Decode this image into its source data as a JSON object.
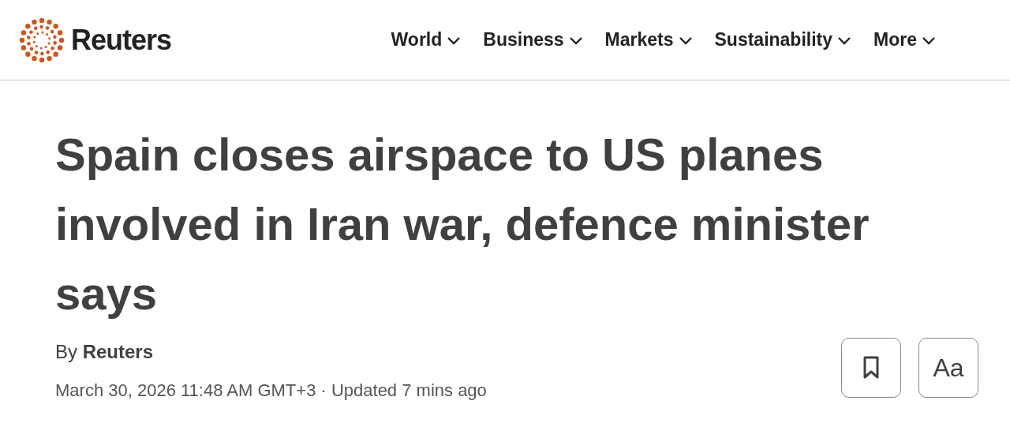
{
  "header": {
    "logo_text": "Reuters",
    "nav": [
      {
        "label": "World",
        "expanded": false
      },
      {
        "label": "Business",
        "expanded": false
      },
      {
        "label": "Markets",
        "expanded": false
      },
      {
        "label": "Sustainability",
        "expanded": false
      },
      {
        "label": "More",
        "expanded": false
      }
    ]
  },
  "article": {
    "headline": "Spain closes airspace to US planes involved in Iran war, defence minister says",
    "byline": "By **Reuters**",
    "dateline": "March 30, 2026 11:48 AM GMT+3 · Updated 7 mins ago",
    "text_size_button": "Aa"
  }
}
